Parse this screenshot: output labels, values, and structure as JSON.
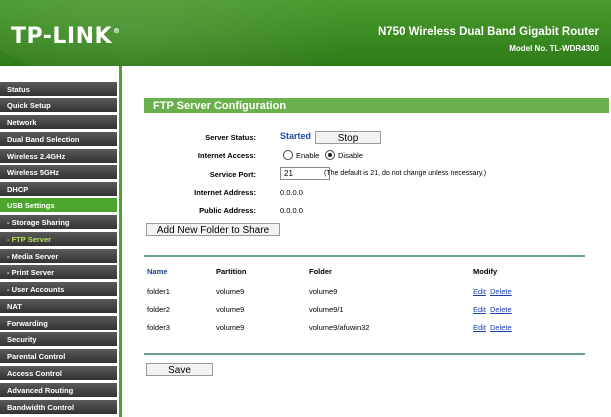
{
  "header": {
    "logo": "TP-LINK",
    "logo_reg": "®",
    "product": "N750 Wireless Dual Band Gigabit Router",
    "model": "Model No. TL-WDR4300"
  },
  "sidebar": {
    "items": [
      {
        "label": "Status"
      },
      {
        "label": "Quick Setup"
      },
      {
        "label": "Network"
      },
      {
        "label": "Dual Band Selection"
      },
      {
        "label": "Wireless 2.4GHz"
      },
      {
        "label": "Wireless 5GHz"
      },
      {
        "label": "DHCP"
      },
      {
        "label": "USB Settings"
      },
      {
        "label": "- Storage Sharing"
      },
      {
        "label": "- FTP Server"
      },
      {
        "label": "- Media Server"
      },
      {
        "label": "- Print Server"
      },
      {
        "label": "- User Accounts"
      },
      {
        "label": "NAT"
      },
      {
        "label": "Forwarding"
      },
      {
        "label": "Security"
      },
      {
        "label": "Parental Control"
      },
      {
        "label": "Access Control"
      },
      {
        "label": "Advanced Routing"
      },
      {
        "label": "Bandwidth Control"
      }
    ]
  },
  "main": {
    "section_title": "FTP Server Configuration",
    "server_status": {
      "label": "Server Status:",
      "value": "Started",
      "button": "Stop"
    },
    "internet_access": {
      "label": "Internet Access:",
      "enable": "Enable",
      "disable": "Disable",
      "selected": "Disable"
    },
    "service_port": {
      "label": "Service Port:",
      "value": "21",
      "hint": "(The default is 21, do not change unless necessary.)"
    },
    "internet_address": {
      "label": "Internet Address:",
      "value": "0.0.0.0"
    },
    "public_address": {
      "label": "Public Address:",
      "value": "0.0.0.0"
    },
    "add_folder_button": "Add New Folder to Share",
    "table": {
      "headers": [
        "Name",
        "Partition",
        "Folder",
        "Modify"
      ],
      "rows": [
        {
          "name": "folder1",
          "partition": "volume9",
          "folder": "volume9",
          "edit": "Edit",
          "delete": "Delete"
        },
        {
          "name": "folder2",
          "partition": "volume9",
          "folder": "volume9/1",
          "edit": "Edit",
          "delete": "Delete"
        },
        {
          "name": "folder3",
          "partition": "volume9",
          "folder": "volume9/afuwin32",
          "edit": "Edit",
          "delete": "Delete"
        }
      ]
    },
    "save_button": "Save"
  },
  "colors": {
    "brand_green": "#4ca52c",
    "header_green": "#3b8a22",
    "link_blue": "#1c3ea8",
    "status_blue": "#1f4aa8"
  }
}
